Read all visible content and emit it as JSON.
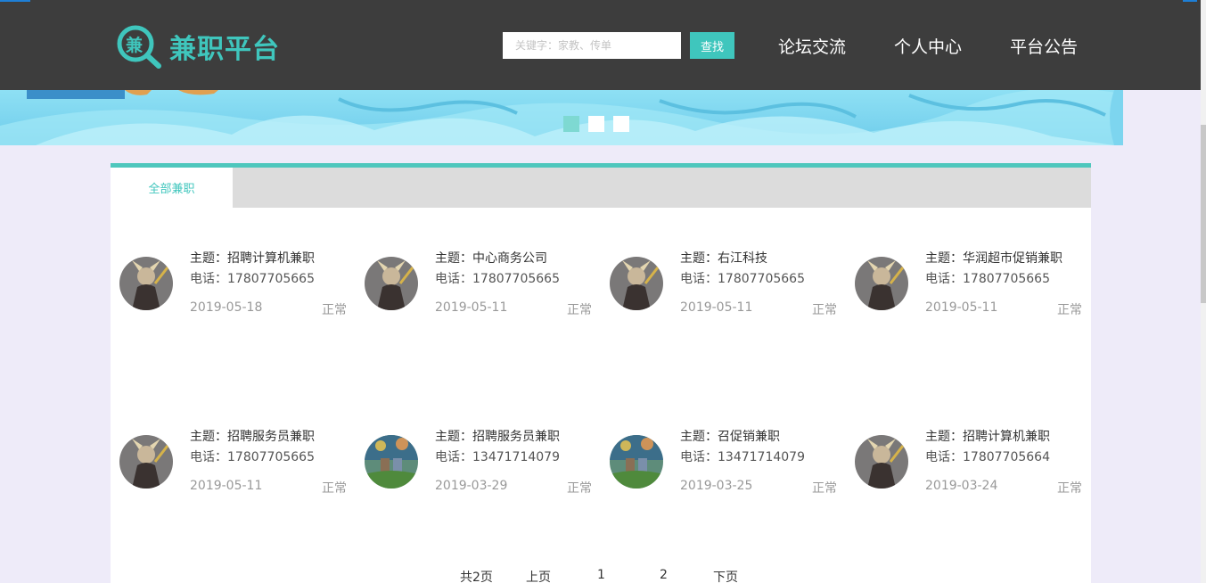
{
  "header": {
    "logo_glyph": "兼",
    "title": "兼职平台",
    "search_placeholder": "关键字：家教、传单",
    "search_button": "查找",
    "nav": [
      "论坛交流",
      "个人中心",
      "平台公告"
    ]
  },
  "colors": {
    "accent": "#3fc6bd",
    "header_bg": "#3d3d3d",
    "page_bg": "#eeebf9",
    "tab_bar": "#dcdcdc"
  },
  "carousel": {
    "slide_count": 3,
    "active_index": 0
  },
  "tabs": {
    "active": "全部兼职"
  },
  "jobs": [
    {
      "subject": "主题：招聘计算机兼职",
      "phone": "电话：17807705665",
      "date": "2019-05-18",
      "status": "正常",
      "avatar": "warrior-avatar-icon"
    },
    {
      "subject": "主题：中心商务公司",
      "phone": "电话：17807705665",
      "date": "2019-05-11",
      "status": "正常",
      "avatar": "warrior-avatar-icon"
    },
    {
      "subject": "主题：右江科技",
      "phone": "电话：17807705665",
      "date": "2019-05-11",
      "status": "正常",
      "avatar": "warrior-avatar-icon"
    },
    {
      "subject": "主题：华润超市促销兼职",
      "phone": "电话：17807705665",
      "date": "2019-05-11",
      "status": "正常",
      "avatar": "warrior-avatar-icon"
    },
    {
      "subject": "主题：招聘服务员兼职",
      "phone": "电话：17807705665",
      "date": "2019-05-11",
      "status": "正常",
      "avatar": "warrior-avatar-icon"
    },
    {
      "subject": "主题：招聘服务员兼职",
      "phone": "电话：13471714079",
      "date": "2019-03-29",
      "status": "正常",
      "avatar": "fireworks-avatar-icon"
    },
    {
      "subject": "主题：召促销兼职",
      "phone": "电话：13471714079",
      "date": "2019-03-25",
      "status": "正常",
      "avatar": "fireworks-avatar-icon"
    },
    {
      "subject": "主题：招聘计算机兼职",
      "phone": "电话：17807705664",
      "date": "2019-03-24",
      "status": "正常",
      "avatar": "warrior-avatar-icon"
    }
  ],
  "pagination": {
    "total": "共2页",
    "prev": "上页",
    "page1": "1",
    "page2": "2",
    "next": "下页"
  }
}
